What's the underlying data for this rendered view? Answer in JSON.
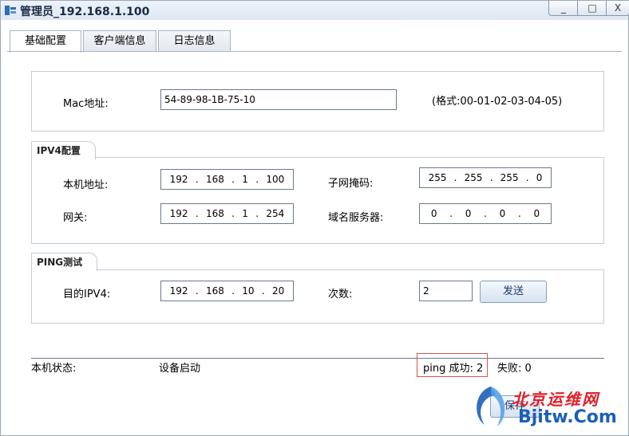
{
  "window": {
    "title": "管理员_192.168.1.100",
    "controls": [
      "_",
      "□",
      "X"
    ]
  },
  "tabs": [
    "基础配置",
    "客户端信息",
    "日志信息"
  ],
  "mac": {
    "label": "Mac地址:",
    "value": "54-89-98-1B-75-10",
    "hint": "(格式:00-01-02-03-04-05)"
  },
  "ipv4": {
    "group_label": "IPV4配置",
    "local_label": "本机地址:",
    "local_ip": [
      "192",
      "168",
      "1",
      "100"
    ],
    "mask_label": "子网掩码:",
    "mask": [
      "255",
      "255",
      "255",
      "0"
    ],
    "gateway_label": "网关:",
    "gateway": [
      "192",
      "168",
      "1",
      "254"
    ],
    "dns_label": "域名服务器:",
    "dns": [
      "0",
      "0",
      "0",
      "0"
    ]
  },
  "ping": {
    "group_label": "PING测试",
    "target_label": "目的IPV4:",
    "target": [
      "192",
      "168",
      "10",
      "20"
    ],
    "count_label": "次数:",
    "count_value": "2",
    "send_button": "发送"
  },
  "status": {
    "label": "本机状态:",
    "value": "设备启动",
    "ping_success": "ping 成功: 2",
    "fail": "失败: 0"
  },
  "footer": {
    "save_button": "保存"
  },
  "watermark": {
    "cn": "北京运维网",
    "en": "Bjitw.Com"
  }
}
